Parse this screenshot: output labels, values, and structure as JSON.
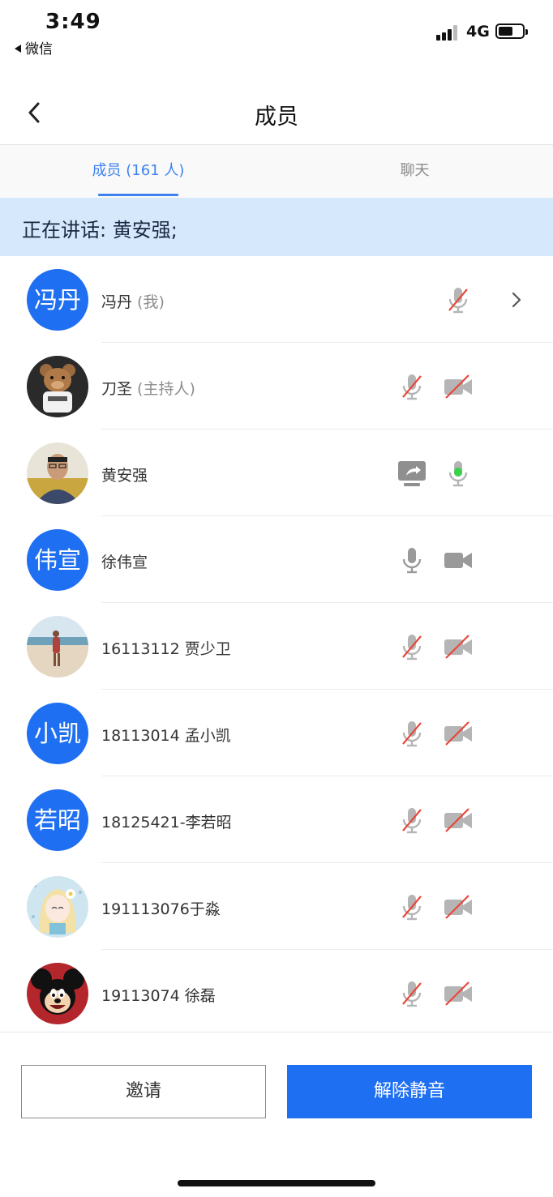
{
  "status_bar": {
    "time": "3:49",
    "back_app": "微信",
    "network": "4G",
    "battery_level": 0.6
  },
  "nav": {
    "title": "成员"
  },
  "tabs": {
    "members": "成员 (161 人)",
    "chat": "聊天"
  },
  "banner": {
    "speaking": "正在讲话: 黄安强;"
  },
  "members": [
    {
      "avatar_text": "冯丹",
      "name": "冯丹",
      "tag": " (我)",
      "icons": [
        "mic-muted-icon"
      ],
      "chevron": true
    },
    {
      "avatar_image": "teddy-bear-photo",
      "name": "刀圣",
      "tag": " (主持人)",
      "icons": [
        "mic-muted-icon",
        "camera-off-icon"
      ]
    },
    {
      "avatar_image": "man-portrait-photo",
      "name": "黄安强",
      "tag": "",
      "icons": [
        "screen-share-icon",
        "mic-active-icon"
      ]
    },
    {
      "avatar_text": "伟宣",
      "name": "徐伟宣",
      "tag": "",
      "icons": [
        "mic-icon",
        "camera-icon"
      ]
    },
    {
      "avatar_image": "beach-photo",
      "name": "16113112 贾少卫",
      "tag": "",
      "icons": [
        "mic-muted-icon",
        "camera-off-icon"
      ]
    },
    {
      "avatar_text": "小凯",
      "name": "18113014 孟小凯",
      "tag": "",
      "icons": [
        "mic-muted-icon",
        "camera-off-icon"
      ]
    },
    {
      "avatar_text": "若昭",
      "name": "18125421-李若昭",
      "tag": "",
      "icons": [
        "mic-muted-icon",
        "camera-off-icon"
      ]
    },
    {
      "avatar_image": "cartoon-girl-illustration",
      "name": "191113076于淼",
      "tag": "",
      "icons": [
        "mic-muted-icon",
        "camera-off-icon"
      ]
    },
    {
      "avatar_image": "mickey-mouse-image",
      "name": "19113074 徐磊",
      "tag": "",
      "icons": [
        "mic-muted-icon",
        "camera-off-icon"
      ]
    }
  ],
  "buttons": {
    "invite": "邀请",
    "unmute": "解除静音"
  },
  "colors": {
    "accent": "#1f6ff2",
    "tab_active": "#3e82f0",
    "banner_bg": "#d6e8fb",
    "muted_slash": "#e8483a",
    "mic_active": "#3bd14a"
  }
}
